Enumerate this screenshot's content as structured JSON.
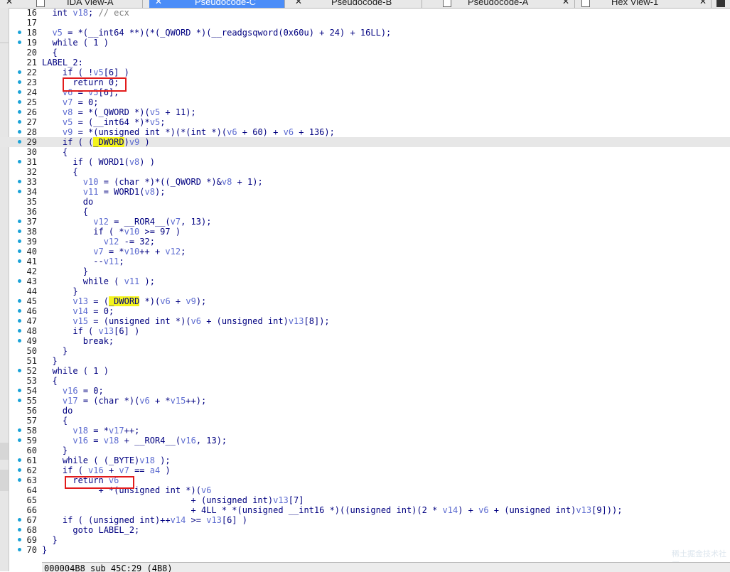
{
  "tabs": [
    {
      "label": "IDA View-A",
      "active": false
    },
    {
      "label": "Pseudocode-C",
      "active": true
    },
    {
      "label": "Pseudocode-B",
      "active": false
    },
    {
      "label": "Pseudocode-A",
      "active": false
    },
    {
      "label": "Hex View-1",
      "active": false
    }
  ],
  "close_glyph": "✕",
  "colors": {
    "accent": "#4b8df8",
    "highlight": "#f3f31c",
    "box": "#e21b1b",
    "dot": "#1aa3d8",
    "keyword": "#000080",
    "variable": "#5b6ad0"
  },
  "code_lines": [
    {
      "n": "16",
      "dot": false,
      "text": "  int v18; // ecx"
    },
    {
      "n": "17",
      "dot": false,
      "text": ""
    },
    {
      "n": "18",
      "dot": true,
      "text": "  v5 = *(__int64 **)(*(_QWORD *)(__readgsqword(0x60u) + 24) + 16LL);"
    },
    {
      "n": "19",
      "dot": true,
      "text": "  while ( 1 )"
    },
    {
      "n": "20",
      "dot": false,
      "text": "  {"
    },
    {
      "n": "21",
      "dot": false,
      "text": "LABEL_2:"
    },
    {
      "n": "22",
      "dot": true,
      "text": "    if ( !v5[6] )"
    },
    {
      "n": "23",
      "dot": true,
      "text": "      return 0;"
    },
    {
      "n": "24",
      "dot": true,
      "text": "    v6 = v5[6];"
    },
    {
      "n": "25",
      "dot": true,
      "text": "    v7 = 0;"
    },
    {
      "n": "26",
      "dot": true,
      "text": "    v8 = *(_QWORD *)(v5 + 11);"
    },
    {
      "n": "27",
      "dot": true,
      "text": "    v5 = (__int64 *)*v5;"
    },
    {
      "n": "28",
      "dot": true,
      "text": "    v9 = *(unsigned int *)(*(int *)(v6 + 60) + v6 + 136);"
    },
    {
      "n": "29",
      "dot": true,
      "text": "    if ( (_DWORD)v9 )",
      "current": true
    },
    {
      "n": "30",
      "dot": false,
      "text": "    {"
    },
    {
      "n": "31",
      "dot": true,
      "text": "      if ( WORD1(v8) )"
    },
    {
      "n": "32",
      "dot": false,
      "text": "      {"
    },
    {
      "n": "33",
      "dot": true,
      "text": "        v10 = (char *)*((_QWORD *)&v8 + 1);"
    },
    {
      "n": "34",
      "dot": true,
      "text": "        v11 = WORD1(v8);"
    },
    {
      "n": "35",
      "dot": false,
      "text": "        do"
    },
    {
      "n": "36",
      "dot": false,
      "text": "        {"
    },
    {
      "n": "37",
      "dot": true,
      "text": "          v12 = __ROR4__(v7, 13);"
    },
    {
      "n": "38",
      "dot": true,
      "text": "          if ( *v10 >= 97 )"
    },
    {
      "n": "39",
      "dot": true,
      "text": "            v12 -= 32;"
    },
    {
      "n": "40",
      "dot": true,
      "text": "          v7 = *v10++ + v12;"
    },
    {
      "n": "41",
      "dot": true,
      "text": "          --v11;"
    },
    {
      "n": "42",
      "dot": false,
      "text": "        }"
    },
    {
      "n": "43",
      "dot": true,
      "text": "        while ( v11 );"
    },
    {
      "n": "44",
      "dot": false,
      "text": "      }"
    },
    {
      "n": "45",
      "dot": true,
      "text": "      v13 = (_DWORD *)(v6 + v9);"
    },
    {
      "n": "46",
      "dot": true,
      "text": "      v14 = 0;"
    },
    {
      "n": "47",
      "dot": true,
      "text": "      v15 = (unsigned int *)(v6 + (unsigned int)v13[8]);"
    },
    {
      "n": "48",
      "dot": true,
      "text": "      if ( v13[6] )"
    },
    {
      "n": "49",
      "dot": true,
      "text": "        break;"
    },
    {
      "n": "50",
      "dot": false,
      "text": "    }"
    },
    {
      "n": "51",
      "dot": false,
      "text": "  }"
    },
    {
      "n": "52",
      "dot": true,
      "text": "  while ( 1 )"
    },
    {
      "n": "53",
      "dot": false,
      "text": "  {"
    },
    {
      "n": "54",
      "dot": true,
      "text": "    v16 = 0;"
    },
    {
      "n": "55",
      "dot": true,
      "text": "    v17 = (char *)(v6 + *v15++);"
    },
    {
      "n": "56",
      "dot": false,
      "text": "    do"
    },
    {
      "n": "57",
      "dot": false,
      "text": "    {"
    },
    {
      "n": "58",
      "dot": true,
      "text": "      v18 = *v17++;"
    },
    {
      "n": "59",
      "dot": true,
      "text": "      v16 = v18 + __ROR4__(v16, 13);"
    },
    {
      "n": "60",
      "dot": false,
      "text": "    }"
    },
    {
      "n": "61",
      "dot": true,
      "text": "    while ( (_BYTE)v18 );"
    },
    {
      "n": "62",
      "dot": true,
      "text": "    if ( v16 + v7 == a4 )"
    },
    {
      "n": "63",
      "dot": true,
      "text": "      return v6"
    },
    {
      "n": "64",
      "dot": false,
      "text": "           + *(unsigned int *)(v6"
    },
    {
      "n": "65",
      "dot": false,
      "text": "                             + (unsigned int)v13[7]"
    },
    {
      "n": "66",
      "dot": false,
      "text": "                             + 4LL * *(unsigned __int16 *)((unsigned int)(2 * v14) + v6 + (unsigned int)v13[9]));"
    },
    {
      "n": "67",
      "dot": true,
      "text": "    if ( (unsigned int)++v14 >= v13[6] )"
    },
    {
      "n": "68",
      "dot": true,
      "text": "      goto LABEL_2;"
    },
    {
      "n": "69",
      "dot": true,
      "text": "  }"
    },
    {
      "n": "70",
      "dot": true,
      "text": "}"
    }
  ],
  "status": {
    "text": "000004B8 sub_45C:29 (4B8)"
  },
  "watermark": "稀土掘金技术社区"
}
